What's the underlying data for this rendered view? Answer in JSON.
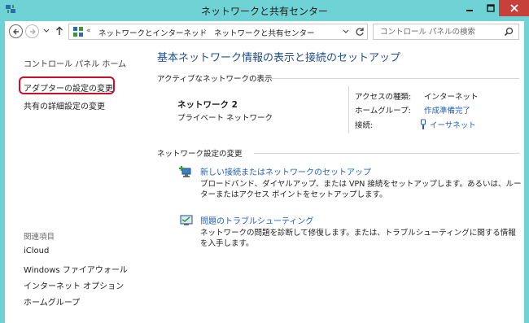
{
  "window": {
    "title": "ネットワークと共有センター",
    "colors": {
      "titlebar": "#6fd3d6",
      "close": "#c7403a",
      "link": "#1f5fb8",
      "heading": "#1f4f8e",
      "highlight": "#c8102e"
    }
  },
  "address_bar": {
    "overflow": "«",
    "crumbs": [
      "ネットワークとインターネット",
      "ネットワークと共有センター"
    ],
    "separator": "›"
  },
  "search": {
    "placeholder": "コントロール パネルの検索"
  },
  "sidebar": {
    "home": "コントロール パネル ホーム",
    "adapter_settings": "アダプターの設定の変更",
    "advanced_sharing": "共有の詳細設定の変更",
    "see_also_title": "関連項目",
    "see_also": [
      "iCloud",
      "Windows ファイアウォール",
      "インターネット オプション",
      "ホームグループ"
    ]
  },
  "main": {
    "heading": "基本ネットワーク情報の表示と接続のセットアップ",
    "active_networks_label": "アクティブなネットワークの表示",
    "network": {
      "name": "ネットワーク 2",
      "type": "プライベート ネットワーク",
      "access_type_label": "アクセスの種類:",
      "access_type_value": "インターネット",
      "homegroup_label": "ホームグループ:",
      "homegroup_value": "作成準備完了",
      "connection_label": "接続:",
      "connection_value": "イーサネット"
    },
    "change_settings_label": "ネットワーク設定の変更",
    "tasks": [
      {
        "link": "新しい接続またはネットワークのセットアップ",
        "description": "ブロードバンド、ダイヤルアップ、または VPN 接続をセットアップします。あるいは、ルーターまたはアクセス ポイントをセットアップします。"
      },
      {
        "link": "問題のトラブルシューティング",
        "description": "ネットワークの問題を診断して修復します。または、トラブルシューティングに関する情報を入手します。"
      }
    ]
  }
}
